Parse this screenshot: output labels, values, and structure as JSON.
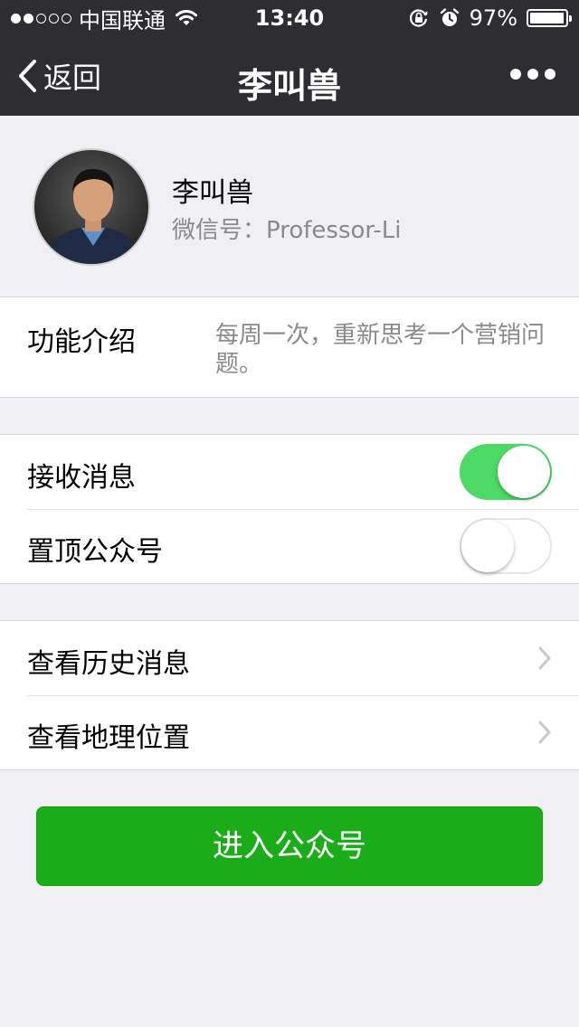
{
  "status_bar": {
    "carrier": "中国联通",
    "time": "13:40",
    "battery": "97%",
    "battery_level": 0.97,
    "signal_icon": "signal-dots-icon",
    "wifi_icon": "wifi-icon",
    "lock_icon": "rotation-lock-icon",
    "alarm_icon": "alarm-icon"
  },
  "nav": {
    "back_label": "返回",
    "title": "李叫兽",
    "more_icon": "more-icon"
  },
  "profile": {
    "name": "李叫兽",
    "wechat_id": "微信号：Professor-Li"
  },
  "intro": {
    "label": "功能介绍",
    "text": "每周一次，重新思考一个营销问题。"
  },
  "settings": {
    "receive_messages": {
      "label": "接收消息",
      "enabled": true
    },
    "pin_account": {
      "label": "置顶公众号",
      "enabled": false
    }
  },
  "links": {
    "history": {
      "label": "查看历史消息"
    },
    "location": {
      "label": "查看地理位置"
    }
  },
  "enter_button": "进入公众号",
  "colors": {
    "header_bg": "#2e2e32",
    "toggle_on": "#4cd964",
    "primary_green": "#1aad19",
    "page_bg": "#efeff4"
  }
}
